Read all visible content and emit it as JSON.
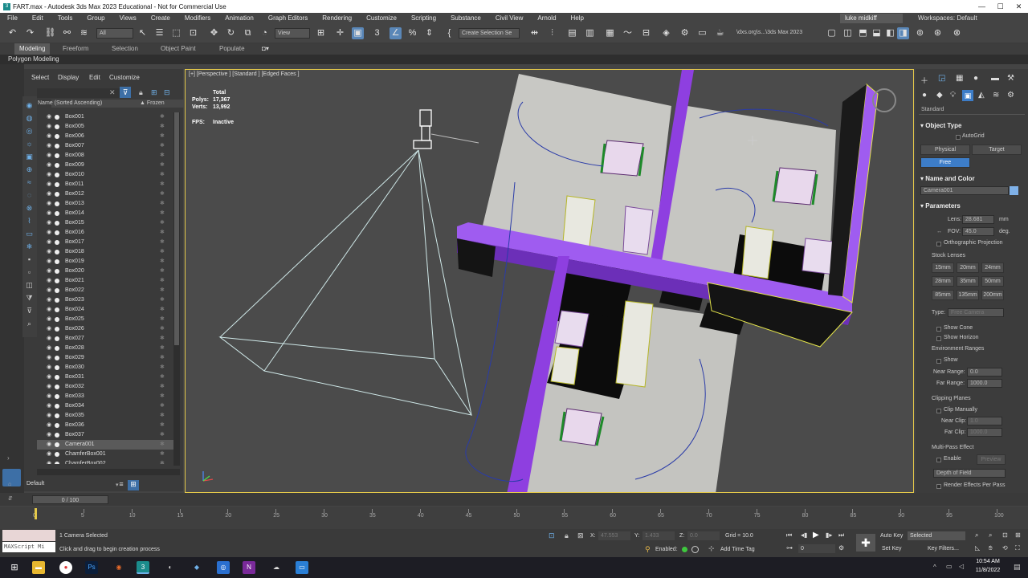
{
  "window": {
    "title": "FART.max - Autodesk 3ds Max 2023 Educational - Not for Commercial Use",
    "controls": [
      "—",
      "☐",
      "✕"
    ]
  },
  "menu": {
    "items": [
      "File",
      "Edit",
      "Tools",
      "Group",
      "Views",
      "Create",
      "Modifiers",
      "Animation",
      "Graph Editors",
      "Rendering",
      "Customize",
      "Scripting",
      "Substance",
      "Civil View",
      "Arnold",
      "Help"
    ],
    "user": "luke midkiff",
    "workspaces_label": "Workspaces:",
    "workspaces_value": "Default"
  },
  "toolbar": {
    "filter_value": "All",
    "refcoord_value": "View",
    "selection_set_value": "Create Selection Se",
    "project_path": "\\dxs.org\\s...\\3ds Max 2023"
  },
  "ribbon": {
    "tabs": [
      "Modeling",
      "Freeform",
      "Selection",
      "Object Paint",
      "Populate"
    ],
    "sub": "Polygon Modeling"
  },
  "scene_explorer": {
    "menu": [
      "Select",
      "Display",
      "Edit",
      "Customize"
    ],
    "col_name": "Name (Sorted Ascending)",
    "col_frozen": "▲ Frozen",
    "rows": [
      "Box001",
      "Box005",
      "Box006",
      "Box007",
      "Box008",
      "Box009",
      "Box010",
      "Box011",
      "Box012",
      "Box013",
      "Box014",
      "Box015",
      "Box016",
      "Box017",
      "Box018",
      "Box019",
      "Box020",
      "Box021",
      "Box022",
      "Box023",
      "Box024",
      "Box025",
      "Box026",
      "Box027",
      "Box028",
      "Box029",
      "Box030",
      "Box031",
      "Box032",
      "Box033",
      "Box034",
      "Box035",
      "Box036",
      "Box037",
      "Camera001",
      "ChamferBox001",
      "ChamferBox002"
    ],
    "selected_row": "Camera001",
    "layer": "Default"
  },
  "viewport": {
    "label": "[+] [Perspective ] [Standard ] [Edged Faces ]",
    "stats": {
      "total_label": "Total",
      "polys_label": "Polys:",
      "polys": "17,367",
      "verts_label": "Verts:",
      "verts": "13,992",
      "fps_label": "FPS:",
      "fps": "Inactive"
    }
  },
  "command_panel": {
    "category": "Standard",
    "object_type_title": "Object Type",
    "autogrid": "AutoGrid",
    "buttons": [
      "Physical",
      "Target",
      "Free"
    ],
    "active_button": "Free",
    "name_color_title": "Name and Color",
    "object_name": "Camera001",
    "swatch_color": "#7fb1e8",
    "parameters_title": "Parameters",
    "lens_label": "Lens:",
    "lens_value": "28.681",
    "lens_unit": "mm",
    "fov_label": "FOV:",
    "fov_value": "45.0",
    "fov_unit": "deg.",
    "ortho": "Orthographic Projection",
    "stock_lenses": "Stock Lenses",
    "lenses": [
      "15mm",
      "20mm",
      "24mm",
      "28mm",
      "35mm",
      "50mm",
      "85mm",
      "135mm",
      "200mm"
    ],
    "type_label": "Type:",
    "type_value": "Free Camera",
    "show_cone": "Show Cone",
    "show_horizon": "Show Horizon",
    "env_ranges": "Environment Ranges",
    "env_show": "Show",
    "near_range_label": "Near Range:",
    "near_range_value": "0.0",
    "far_range_label": "Far Range:",
    "far_range_value": "1000.0",
    "clipping_planes": "Clipping Planes",
    "clip_manually": "Clip Manually",
    "near_clip_label": "Near Clip:",
    "near_clip_value": "1.0",
    "far_clip_label": "Far Clip:",
    "far_clip_value": "1000.0",
    "multipass": "Multi-Pass Effect",
    "enable": "Enable",
    "preview": "Preview",
    "effect_value": "Depth of Field",
    "render_effects": "Render Effects Per Pass"
  },
  "timeline": {
    "slider_text": "0 / 100",
    "ticks": [
      "0",
      "5",
      "10",
      "15",
      "20",
      "25",
      "30",
      "35",
      "40",
      "45",
      "50",
      "55",
      "60",
      "65",
      "70",
      "75",
      "80",
      "85",
      "90",
      "95",
      "100"
    ]
  },
  "status": {
    "maxscript": "MAXScript Mi",
    "selected_text": "1 Camera Selected",
    "prompt": "Click and drag to begin creation process",
    "x_label": "X:",
    "x_value": "47.553",
    "y_label": "Y:",
    "y_value": "1.433",
    "z_label": "Z:",
    "z_value": "0.0",
    "grid_label": "Grid = 10.0",
    "enabled_label": "Enabled:",
    "add_time_tag": "Add Time Tag",
    "autokey": "Auto Key",
    "setkey": "Set Key",
    "selected_dd": "Selected",
    "key_filters": "Key Filters...",
    "frame_value": "0"
  },
  "taskbar": {
    "time": "10:54 AM",
    "date": "11/8/2022"
  }
}
